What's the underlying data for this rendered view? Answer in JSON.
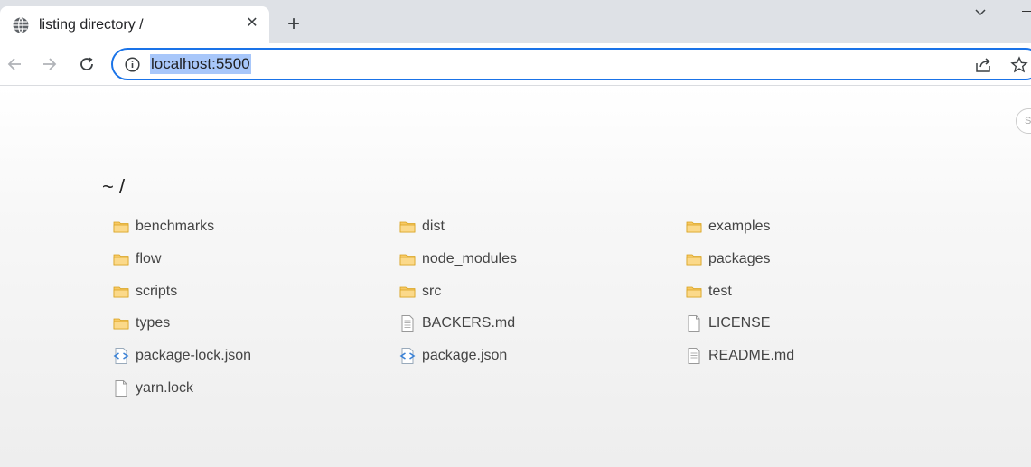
{
  "browser": {
    "tab_title": "listing directory /",
    "tab_close": "✕",
    "new_tab": "+",
    "url": "localhost:5500"
  },
  "page": {
    "heading": "~ /",
    "side_badge": "S",
    "entries": [
      {
        "name": "benchmarks",
        "type": "folder"
      },
      {
        "name": "dist",
        "type": "folder"
      },
      {
        "name": "examples",
        "type": "folder"
      },
      {
        "name": "flow",
        "type": "folder"
      },
      {
        "name": "node_modules",
        "type": "folder"
      },
      {
        "name": "packages",
        "type": "folder"
      },
      {
        "name": "scripts",
        "type": "folder"
      },
      {
        "name": "src",
        "type": "folder"
      },
      {
        "name": "test",
        "type": "folder"
      },
      {
        "name": "types",
        "type": "folder"
      },
      {
        "name": "BACKERS.md",
        "type": "text-file"
      },
      {
        "name": "LICENSE",
        "type": "blank-file"
      },
      {
        "name": "package-lock.json",
        "type": "code-file"
      },
      {
        "name": "package.json",
        "type": "code-file"
      },
      {
        "name": "README.md",
        "type": "text-file"
      },
      {
        "name": "yarn.lock",
        "type": "blank-file"
      }
    ]
  }
}
